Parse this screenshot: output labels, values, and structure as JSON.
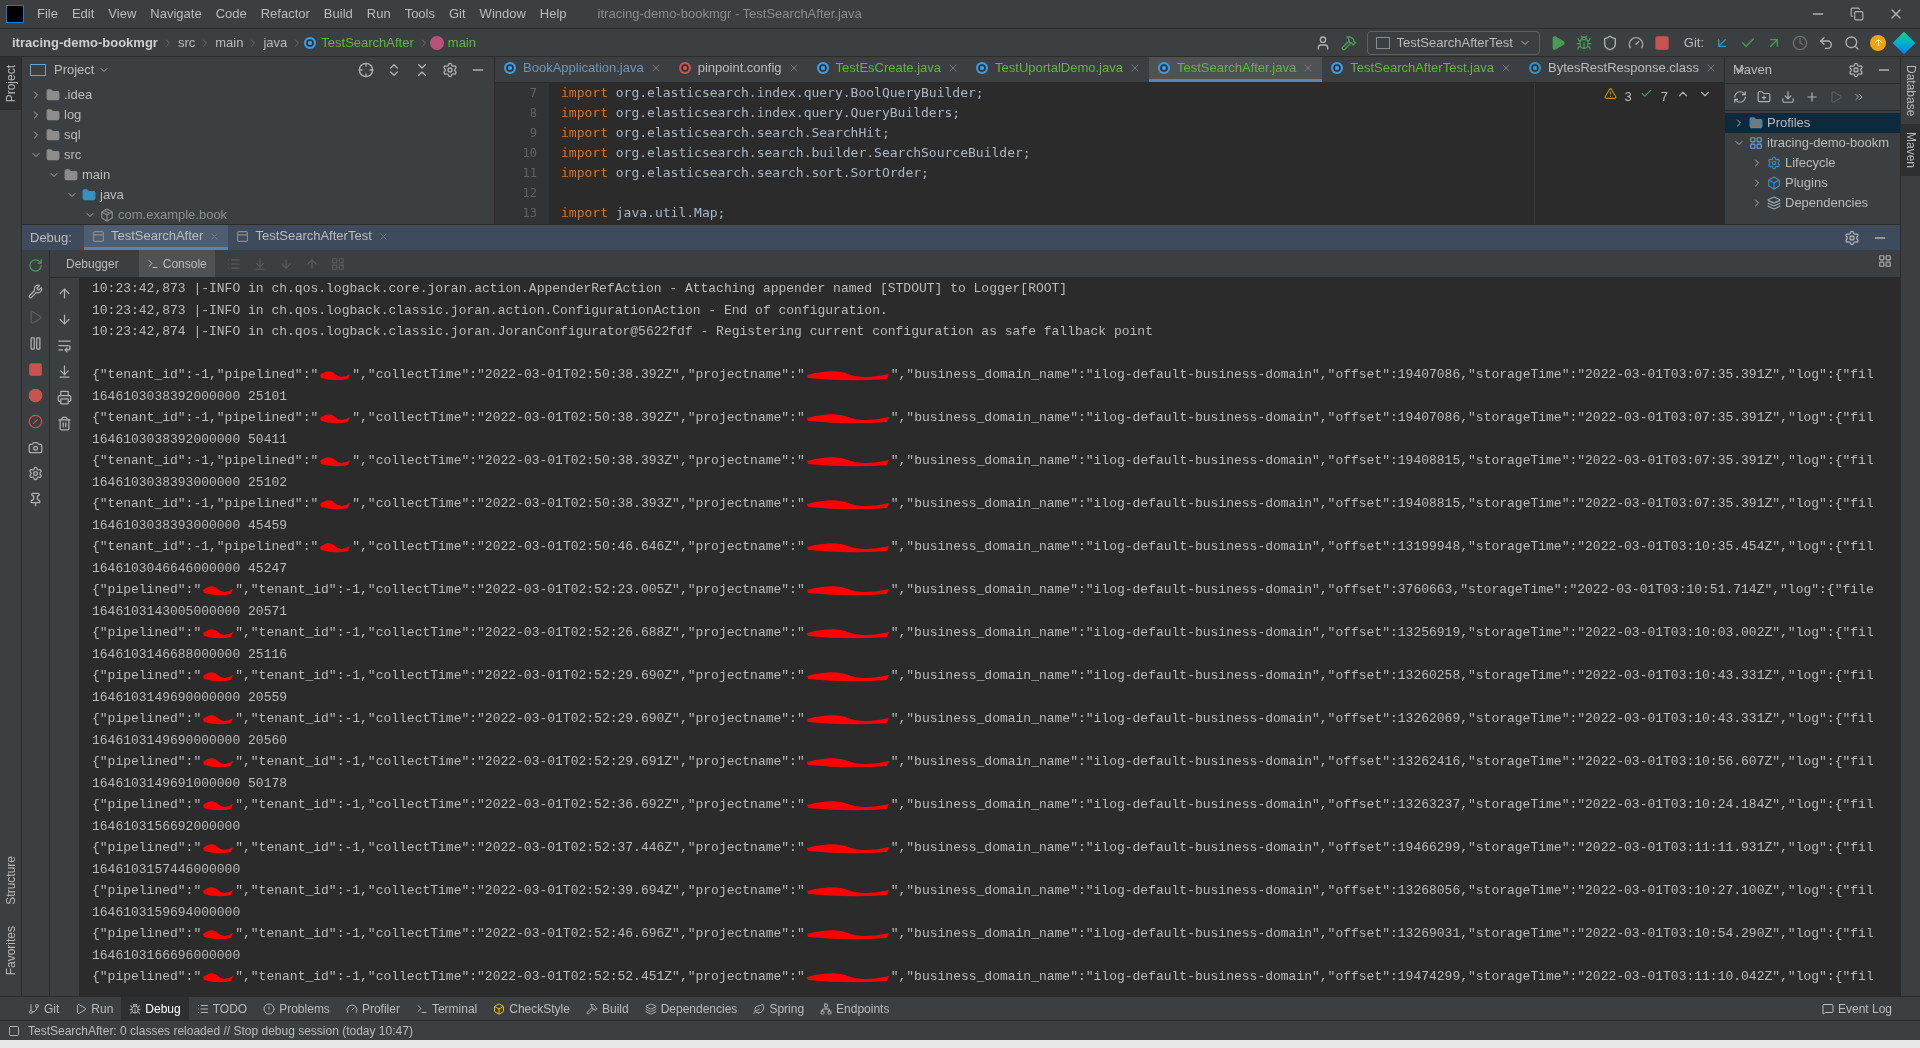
{
  "menu": [
    "File",
    "Edit",
    "View",
    "Navigate",
    "Code",
    "Refactor",
    "Build",
    "Run",
    "Tools",
    "Git",
    "Window",
    "Help"
  ],
  "window_title": "itracing-demo-bookmgr - TestSearchAfter.java",
  "breadcrumb": [
    {
      "label": "itracing-demo-bookmgr",
      "kind": "project"
    },
    {
      "label": "src",
      "kind": "folder"
    },
    {
      "label": "main",
      "kind": "folder"
    },
    {
      "label": "java",
      "kind": "folder"
    },
    {
      "label": "TestSearchAfter",
      "kind": "class"
    },
    {
      "label": "main",
      "kind": "method"
    }
  ],
  "run_config": "TestSearchAfterTest",
  "git_label": "Git:",
  "left_stripe": {
    "top": [
      {
        "label": "Project",
        "selected": true
      }
    ],
    "bottom": [
      {
        "label": "Structure",
        "selected": false
      },
      {
        "label": "Favorites",
        "selected": false
      }
    ]
  },
  "right_stripe": [
    {
      "label": "Database",
      "selected": false
    },
    {
      "label": "Maven",
      "selected": true
    }
  ],
  "project_panel": {
    "title": "Project",
    "tree": [
      {
        "label": ".idea",
        "expanded": false
      },
      {
        "label": "log",
        "expanded": false
      },
      {
        "label": "sql",
        "expanded": false
      },
      {
        "label": "src",
        "expanded": true,
        "children": [
          {
            "label": "main",
            "expanded": true,
            "children": [
              {
                "label": "java",
                "expanded": true,
                "kind": "source",
                "children": [
                  {
                    "label": "com.example.book",
                    "expanded": true,
                    "kind": "package"
                  }
                ]
              }
            ]
          }
        ]
      }
    ]
  },
  "editor": {
    "tabs": [
      {
        "label": "BookApplication.java",
        "selected": false,
        "color": "#6897bb",
        "kind": "class"
      },
      {
        "label": "pinpoint.config",
        "selected": false,
        "color": "#bbbbbb",
        "kind": "config"
      },
      {
        "label": "TestEsCreate.java",
        "selected": false,
        "color": "#62b543",
        "kind": "class"
      },
      {
        "label": "TestUportalDemo.java",
        "selected": false,
        "color": "#62b543",
        "kind": "class"
      },
      {
        "label": "TestSearchAfter.java",
        "selected": true,
        "color": "#62b543",
        "kind": "class"
      },
      {
        "label": "TestSearchAfterTest.java",
        "selected": false,
        "color": "#62b543",
        "kind": "class"
      },
      {
        "label": "BytesRestResponse.class",
        "selected": false,
        "color": "#bbbbbb",
        "kind": "compiled"
      }
    ],
    "warnings": "3",
    "checks": "7",
    "lines": [
      {
        "number": "7",
        "keyword": "import",
        "text": " org.elasticsearch.index.query.BoolQueryBuilder;"
      },
      {
        "number": "8",
        "keyword": "import",
        "text": " org.elasticsearch.index.query.QueryBuilders;"
      },
      {
        "number": "9",
        "keyword": "import",
        "text": " org.elasticsearch.search.SearchHit;"
      },
      {
        "number": "10",
        "keyword": "import",
        "text": " org.elasticsearch.search.builder.SearchSourceBuilder;"
      },
      {
        "number": "11",
        "keyword": "import",
        "text": " org.elasticsearch.search.sort.SortOrder;"
      },
      {
        "number": "12"
      },
      {
        "number": "13",
        "keyword": "import",
        "text": " java.util.Map;"
      }
    ]
  },
  "maven": {
    "title": "Maven",
    "tree": [
      {
        "label": "Profiles",
        "expanded": false,
        "selected": true,
        "kind": "profiles"
      },
      {
        "label": "itracing-demo-bookm",
        "expanded": true,
        "selected": false,
        "kind": "module",
        "children": [
          {
            "label": "Lifecycle",
            "expanded": false,
            "selected": false,
            "kind": "lifecycle"
          },
          {
            "label": "Plugins",
            "expanded": false,
            "selected": false,
            "kind": "plugins"
          },
          {
            "label": "Dependencies",
            "expanded": false,
            "selected": false,
            "kind": "dependencies"
          }
        ]
      }
    ]
  },
  "debug": {
    "label": "Debug:",
    "tabs": [
      {
        "label": "TestSearchAfter",
        "selected": true
      },
      {
        "label": "TestSearchAfterTest",
        "selected": false
      }
    ],
    "subtabs": [
      {
        "label": "Debugger",
        "selected": false
      },
      {
        "label": "Console",
        "selected": true
      }
    ],
    "console": [
      {
        "kind": "text",
        "text": "10:23:42,873 |-INFO in ch.qos.logback.core.joran.action.AppenderRefAction - Attaching appender named [STDOUT] to Logger[ROOT]"
      },
      {
        "kind": "text",
        "text": "10:23:42,873 |-INFO in ch.qos.logback.classic.joran.action.ConfigurationAction - End of configuration."
      },
      {
        "kind": "text",
        "text": "10:23:42,874 |-INFO in ch.qos.logback.classic.joran.JoranConfigurator@5622fdf - Registering current configuration as safe fallback point"
      },
      {
        "kind": "blank"
      },
      {
        "kind": "record",
        "head": "{\"tenant_id\":-1,\"pipelined\":\"",
        "middle": "\",\"collectTime\":\"2022-03-01T02:50:38.392Z\",\"projectname\":\"",
        "tail": "\",\"business_domain_name\":\"ilog-default-business-domain\",\"offset\":19407086,\"storageTime\":\"2022-03-01T03:07:35.391Z\",\"log\":{\"fil"
      },
      {
        "kind": "text",
        "text": "1646103038392000000 25101"
      },
      {
        "kind": "record",
        "head": "{\"tenant_id\":-1,\"pipelined\":\"",
        "middle": "\",\"collectTime\":\"2022-03-01T02:50:38.392Z\",\"projectname\":\"",
        "tail": "\",\"business_domain_name\":\"ilog-default-business-domain\",\"offset\":19407086,\"storageTime\":\"2022-03-01T03:07:35.391Z\",\"log\":{\"fil"
      },
      {
        "kind": "text",
        "text": "1646103038392000000 50411"
      },
      {
        "kind": "record",
        "head": "{\"tenant_id\":-1,\"pipelined\":\"",
        "middle": "\",\"collectTime\":\"2022-03-01T02:50:38.393Z\",\"projectname\":\"",
        "tail": "\",\"business_domain_name\":\"ilog-default-business-domain\",\"offset\":19408815,\"storageTime\":\"2022-03-01T03:07:35.391Z\",\"log\":{\"fil"
      },
      {
        "kind": "text",
        "text": "1646103038393000000 25102"
      },
      {
        "kind": "record",
        "head": "{\"tenant_id\":-1,\"pipelined\":\"",
        "middle": "\",\"collectTime\":\"2022-03-01T02:50:38.393Z\",\"projectname\":\"",
        "tail": "\",\"business_domain_name\":\"ilog-default-business-domain\",\"offset\":19408815,\"storageTime\":\"2022-03-01T03:07:35.391Z\",\"log\":{\"fil"
      },
      {
        "kind": "text",
        "text": "1646103038393000000 45459"
      },
      {
        "kind": "record",
        "head": "{\"tenant_id\":-1,\"pipelined\":\"",
        "middle": "\",\"collectTime\":\"2022-03-01T02:50:46.646Z\",\"projectname\":\"",
        "tail": "\",\"business_domain_name\":\"ilog-default-business-domain\",\"offset\":13199948,\"storageTime\":\"2022-03-01T03:10:35.454Z\",\"log\":{\"fil"
      },
      {
        "kind": "text",
        "text": "1646103046646000000 45247"
      },
      {
        "kind": "record",
        "head": "{\"pipelined\":\"",
        "middle": "\",\"tenant_id\":-1,\"collectTime\":\"2022-03-01T02:52:23.005Z\",\"projectname\":\"",
        "tail": "\",\"business_domain_name\":\"ilog-default-business-domain\",\"offset\":3760663,\"storageTime\":\"2022-03-01T03:10:51.714Z\",\"log\":{\"file"
      },
      {
        "kind": "text",
        "text": "1646103143005000000 20571"
      },
      {
        "kind": "record",
        "head": "{\"pipelined\":\"",
        "middle": "\",\"tenant_id\":-1,\"collectTime\":\"2022-03-01T02:52:26.688Z\",\"projectname\":\"",
        "tail": "\",\"business_domain_name\":\"ilog-default-business-domain\",\"offset\":13256919,\"storageTime\":\"2022-03-01T03:10:03.002Z\",\"log\":{\"fil"
      },
      {
        "kind": "text",
        "text": "1646103146688000000 25116"
      },
      {
        "kind": "record",
        "head": "{\"pipelined\":\"",
        "middle": "\",\"tenant_id\":-1,\"collectTime\":\"2022-03-01T02:52:29.690Z\",\"projectname\":\"",
        "tail": "\",\"business_domain_name\":\"ilog-default-business-domain\",\"offset\":13260258,\"storageTime\":\"2022-03-01T03:10:43.331Z\",\"log\":{\"fil"
      },
      {
        "kind": "text",
        "text": "1646103149690000000 20559"
      },
      {
        "kind": "record",
        "head": "{\"pipelined\":\"",
        "middle": "\",\"tenant_id\":-1,\"collectTime\":\"2022-03-01T02:52:29.690Z\",\"projectname\":\"",
        "tail": "\",\"business_domain_name\":\"ilog-default-business-domain\",\"offset\":13262069,\"storageTime\":\"2022-03-01T03:10:43.331Z\",\"log\":{\"fil"
      },
      {
        "kind": "text",
        "text": "1646103149690000000 20560"
      },
      {
        "kind": "record",
        "head": "{\"pipelined\":\"",
        "middle": "\",\"tenant_id\":-1,\"collectTime\":\"2022-03-01T02:52:29.691Z\",\"projectname\":\"",
        "tail": "\",\"business_domain_name\":\"ilog-default-business-domain\",\"offset\":13262416,\"storageTime\":\"2022-03-01T03:10:56.607Z\",\"log\":{\"fil"
      },
      {
        "kind": "text",
        "text": "1646103149691000000 50178"
      },
      {
        "kind": "record",
        "head": "{\"pipelined\":\"",
        "middle": "\",\"tenant_id\":-1,\"collectTime\":\"2022-03-01T02:52:36.692Z\",\"projectname\":\"",
        "tail": "\",\"business_domain_name\":\"ilog-default-business-domain\",\"offset\":13263237,\"storageTime\":\"2022-03-01T03:10:24.184Z\",\"log\":{\"fil"
      },
      {
        "kind": "text",
        "text": "1646103156692000000"
      },
      {
        "kind": "record",
        "head": "{\"pipelined\":\"",
        "middle": "\",\"tenant_id\":-1,\"collectTime\":\"2022-03-01T02:52:37.446Z\",\"projectname\":\"",
        "tail": "\",\"business_domain_name\":\"ilog-default-business-domain\",\"offset\":19466299,\"storageTime\":\"2022-03-01T03:11:11.931Z\",\"log\":{\"fil"
      },
      {
        "kind": "text",
        "text": "1646103157446000000"
      },
      {
        "kind": "record",
        "head": "{\"pipelined\":\"",
        "middle": "\",\"tenant_id\":-1,\"collectTime\":\"2022-03-01T02:52:39.694Z\",\"projectname\":\"",
        "tail": "\",\"business_domain_name\":\"ilog-default-business-domain\",\"offset\":13268056,\"storageTime\":\"2022-03-01T03:10:27.100Z\",\"log\":{\"fil"
      },
      {
        "kind": "text",
        "text": "1646103159694000000"
      },
      {
        "kind": "record",
        "head": "{\"pipelined\":\"",
        "middle": "\",\"tenant_id\":-1,\"collectTime\":\"2022-03-01T02:52:46.696Z\",\"projectname\":\"",
        "tail": "\",\"business_domain_name\":\"ilog-default-business-domain\",\"offset\":13269031,\"storageTime\":\"2022-03-01T03:10:54.290Z\",\"log\":{\"fil"
      },
      {
        "kind": "text",
        "text": "1646103166696000000"
      },
      {
        "kind": "record",
        "head": "{\"pipelined\":\"",
        "middle": "\",\"tenant_id\":-1,\"collectTime\":\"2022-03-01T02:52:52.451Z\",\"projectname\":\"",
        "tail": "\",\"business_domain_name\":\"ilog-default-business-domain\",\"offset\":19474299,\"storageTime\":\"2022-03-01T03:11:10.042Z\",\"log\":{\"fil"
      }
    ]
  },
  "tool_tabs": [
    {
      "label": "Git",
      "selected": false,
      "kind": "git"
    },
    {
      "label": "Run",
      "selected": false,
      "kind": "run"
    },
    {
      "label": "Debug",
      "selected": true,
      "kind": "debug"
    },
    {
      "label": "TODO",
      "selected": false,
      "kind": "todo"
    },
    {
      "label": "Problems",
      "selected": false,
      "kind": "problems"
    },
    {
      "label": "Profiler",
      "selected": false,
      "kind": "profiler"
    },
    {
      "label": "Terminal",
      "selected": false,
      "kind": "terminal"
    },
    {
      "label": "CheckStyle",
      "selected": false,
      "kind": "checkstyle"
    },
    {
      "label": "Build",
      "selected": false,
      "kind": "build"
    },
    {
      "label": "Dependencies",
      "selected": false,
      "kind": "dependencies"
    },
    {
      "label": "Spring",
      "selected": false,
      "kind": "spring"
    },
    {
      "label": "Endpoints",
      "selected": false,
      "kind": "endpoints"
    }
  ],
  "event_log": "Event Log",
  "status": "TestSearchAfter: 0 classes reloaded // Stop debug session (today 10:47)"
}
